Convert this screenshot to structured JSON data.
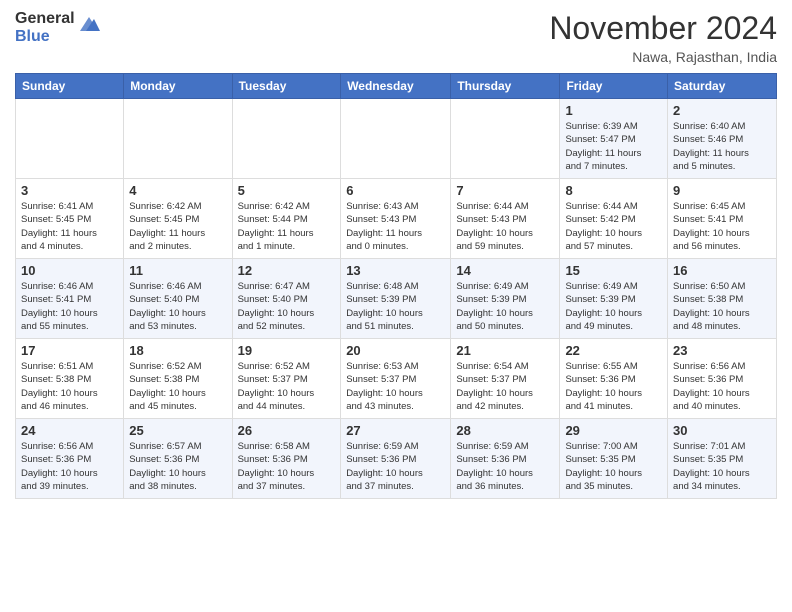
{
  "header": {
    "logo_general": "General",
    "logo_blue": "Blue",
    "month_title": "November 2024",
    "location": "Nawa, Rajasthan, India"
  },
  "weekdays": [
    "Sunday",
    "Monday",
    "Tuesday",
    "Wednesday",
    "Thursday",
    "Friday",
    "Saturday"
  ],
  "weeks": [
    [
      {
        "day": "",
        "info": ""
      },
      {
        "day": "",
        "info": ""
      },
      {
        "day": "",
        "info": ""
      },
      {
        "day": "",
        "info": ""
      },
      {
        "day": "",
        "info": ""
      },
      {
        "day": "1",
        "info": "Sunrise: 6:39 AM\nSunset: 5:47 PM\nDaylight: 11 hours\nand 7 minutes."
      },
      {
        "day": "2",
        "info": "Sunrise: 6:40 AM\nSunset: 5:46 PM\nDaylight: 11 hours\nand 5 minutes."
      }
    ],
    [
      {
        "day": "3",
        "info": "Sunrise: 6:41 AM\nSunset: 5:45 PM\nDaylight: 11 hours\nand 4 minutes."
      },
      {
        "day": "4",
        "info": "Sunrise: 6:42 AM\nSunset: 5:45 PM\nDaylight: 11 hours\nand 2 minutes."
      },
      {
        "day": "5",
        "info": "Sunrise: 6:42 AM\nSunset: 5:44 PM\nDaylight: 11 hours\nand 1 minute."
      },
      {
        "day": "6",
        "info": "Sunrise: 6:43 AM\nSunset: 5:43 PM\nDaylight: 11 hours\nand 0 minutes."
      },
      {
        "day": "7",
        "info": "Sunrise: 6:44 AM\nSunset: 5:43 PM\nDaylight: 10 hours\nand 59 minutes."
      },
      {
        "day": "8",
        "info": "Sunrise: 6:44 AM\nSunset: 5:42 PM\nDaylight: 10 hours\nand 57 minutes."
      },
      {
        "day": "9",
        "info": "Sunrise: 6:45 AM\nSunset: 5:41 PM\nDaylight: 10 hours\nand 56 minutes."
      }
    ],
    [
      {
        "day": "10",
        "info": "Sunrise: 6:46 AM\nSunset: 5:41 PM\nDaylight: 10 hours\nand 55 minutes."
      },
      {
        "day": "11",
        "info": "Sunrise: 6:46 AM\nSunset: 5:40 PM\nDaylight: 10 hours\nand 53 minutes."
      },
      {
        "day": "12",
        "info": "Sunrise: 6:47 AM\nSunset: 5:40 PM\nDaylight: 10 hours\nand 52 minutes."
      },
      {
        "day": "13",
        "info": "Sunrise: 6:48 AM\nSunset: 5:39 PM\nDaylight: 10 hours\nand 51 minutes."
      },
      {
        "day": "14",
        "info": "Sunrise: 6:49 AM\nSunset: 5:39 PM\nDaylight: 10 hours\nand 50 minutes."
      },
      {
        "day": "15",
        "info": "Sunrise: 6:49 AM\nSunset: 5:39 PM\nDaylight: 10 hours\nand 49 minutes."
      },
      {
        "day": "16",
        "info": "Sunrise: 6:50 AM\nSunset: 5:38 PM\nDaylight: 10 hours\nand 48 minutes."
      }
    ],
    [
      {
        "day": "17",
        "info": "Sunrise: 6:51 AM\nSunset: 5:38 PM\nDaylight: 10 hours\nand 46 minutes."
      },
      {
        "day": "18",
        "info": "Sunrise: 6:52 AM\nSunset: 5:38 PM\nDaylight: 10 hours\nand 45 minutes."
      },
      {
        "day": "19",
        "info": "Sunrise: 6:52 AM\nSunset: 5:37 PM\nDaylight: 10 hours\nand 44 minutes."
      },
      {
        "day": "20",
        "info": "Sunrise: 6:53 AM\nSunset: 5:37 PM\nDaylight: 10 hours\nand 43 minutes."
      },
      {
        "day": "21",
        "info": "Sunrise: 6:54 AM\nSunset: 5:37 PM\nDaylight: 10 hours\nand 42 minutes."
      },
      {
        "day": "22",
        "info": "Sunrise: 6:55 AM\nSunset: 5:36 PM\nDaylight: 10 hours\nand 41 minutes."
      },
      {
        "day": "23",
        "info": "Sunrise: 6:56 AM\nSunset: 5:36 PM\nDaylight: 10 hours\nand 40 minutes."
      }
    ],
    [
      {
        "day": "24",
        "info": "Sunrise: 6:56 AM\nSunset: 5:36 PM\nDaylight: 10 hours\nand 39 minutes."
      },
      {
        "day": "25",
        "info": "Sunrise: 6:57 AM\nSunset: 5:36 PM\nDaylight: 10 hours\nand 38 minutes."
      },
      {
        "day": "26",
        "info": "Sunrise: 6:58 AM\nSunset: 5:36 PM\nDaylight: 10 hours\nand 37 minutes."
      },
      {
        "day": "27",
        "info": "Sunrise: 6:59 AM\nSunset: 5:36 PM\nDaylight: 10 hours\nand 37 minutes."
      },
      {
        "day": "28",
        "info": "Sunrise: 6:59 AM\nSunset: 5:36 PM\nDaylight: 10 hours\nand 36 minutes."
      },
      {
        "day": "29",
        "info": "Sunrise: 7:00 AM\nSunset: 5:35 PM\nDaylight: 10 hours\nand 35 minutes."
      },
      {
        "day": "30",
        "info": "Sunrise: 7:01 AM\nSunset: 5:35 PM\nDaylight: 10 hours\nand 34 minutes."
      }
    ]
  ]
}
